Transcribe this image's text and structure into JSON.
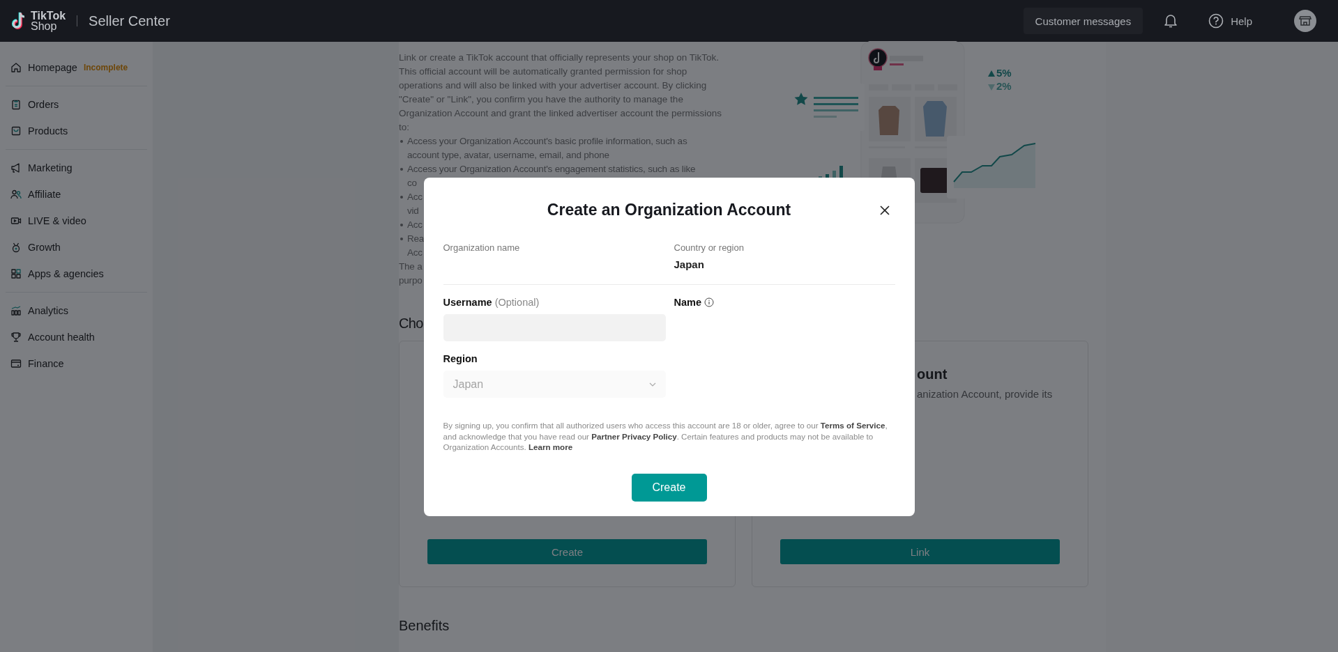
{
  "topbar": {
    "logo_lines": [
      "TikTok",
      "Shop"
    ],
    "title": "Seller Center",
    "customer_messages": "Customer messages",
    "help": "Help"
  },
  "sidebar": {
    "groups": [
      [
        {
          "label": "Homepage",
          "badge": "Incomplete"
        }
      ],
      [
        {
          "label": "Orders"
        },
        {
          "label": "Products"
        }
      ],
      [
        {
          "label": "Marketing"
        },
        {
          "label": "Affiliate"
        },
        {
          "label": "LIVE & video"
        },
        {
          "label": "Growth"
        },
        {
          "label": "Apps & agencies"
        }
      ],
      [
        {
          "label": "Analytics"
        },
        {
          "label": "Account health"
        },
        {
          "label": "Finance"
        }
      ]
    ]
  },
  "intro": {
    "paragraph": "Link or create a TikTok account that officially represents your shop on TikTok. This official account will be automatically granted permission for shop operations and will also be linked with your advertiser account. By clicking \"Create\" or \"Link\", you confirm you have the authority to manage the Organization Account and grant the linked advertiser account the permissions to:",
    "bullets": [
      {
        "lines": [
          "Access your Organization Account's basic profile information, such as",
          "account type, avatar, username, email, and phone"
        ]
      },
      {
        "lines": [
          "Access your Organization Account's engagement statistics, such as like",
          "co"
        ]
      },
      {
        "lines": [
          "Acc",
          "vid"
        ]
      },
      {
        "lines": [
          "Acc"
        ]
      },
      {
        "lines": [
          "Rea",
          "Acc"
        ]
      }
    ],
    "tail_lines": [
      "The a",
      "purpo"
    ]
  },
  "illustration": {
    "stat_up": "5%",
    "stat_down": "2%"
  },
  "choose_heading": "Cho",
  "cards": [
    {
      "button": "Create"
    },
    {
      "title": "ount",
      "description": "anization Account, provide its",
      "button": "Link"
    }
  ],
  "benefits_heading": "Benefits",
  "modal": {
    "title": "Create an Organization Account",
    "organization_name_label": "Organization name",
    "country_label": "Country or region",
    "country_value": "Japan",
    "username_label": "Username",
    "username_hint": "(Optional)",
    "name_label": "Name",
    "region": {
      "label": "Region",
      "value": "Japan",
      "disabled": true
    },
    "legal": [
      {
        "kind": "plain",
        "text": "By signing up, you confirm that all authorized users who access this account are 18 or older, agree to our "
      },
      {
        "kind": "link",
        "text": "Terms of Service"
      },
      {
        "kind": "plain",
        "text": ", and acknowledge that you have read our "
      },
      {
        "kind": "link",
        "text": "Partner Privacy Policy"
      },
      {
        "kind": "plain",
        "text": ". Certain features and products may not be available to Organization Accounts. "
      },
      {
        "kind": "link",
        "text": "Learn more"
      }
    ],
    "create_button": "Create"
  }
}
